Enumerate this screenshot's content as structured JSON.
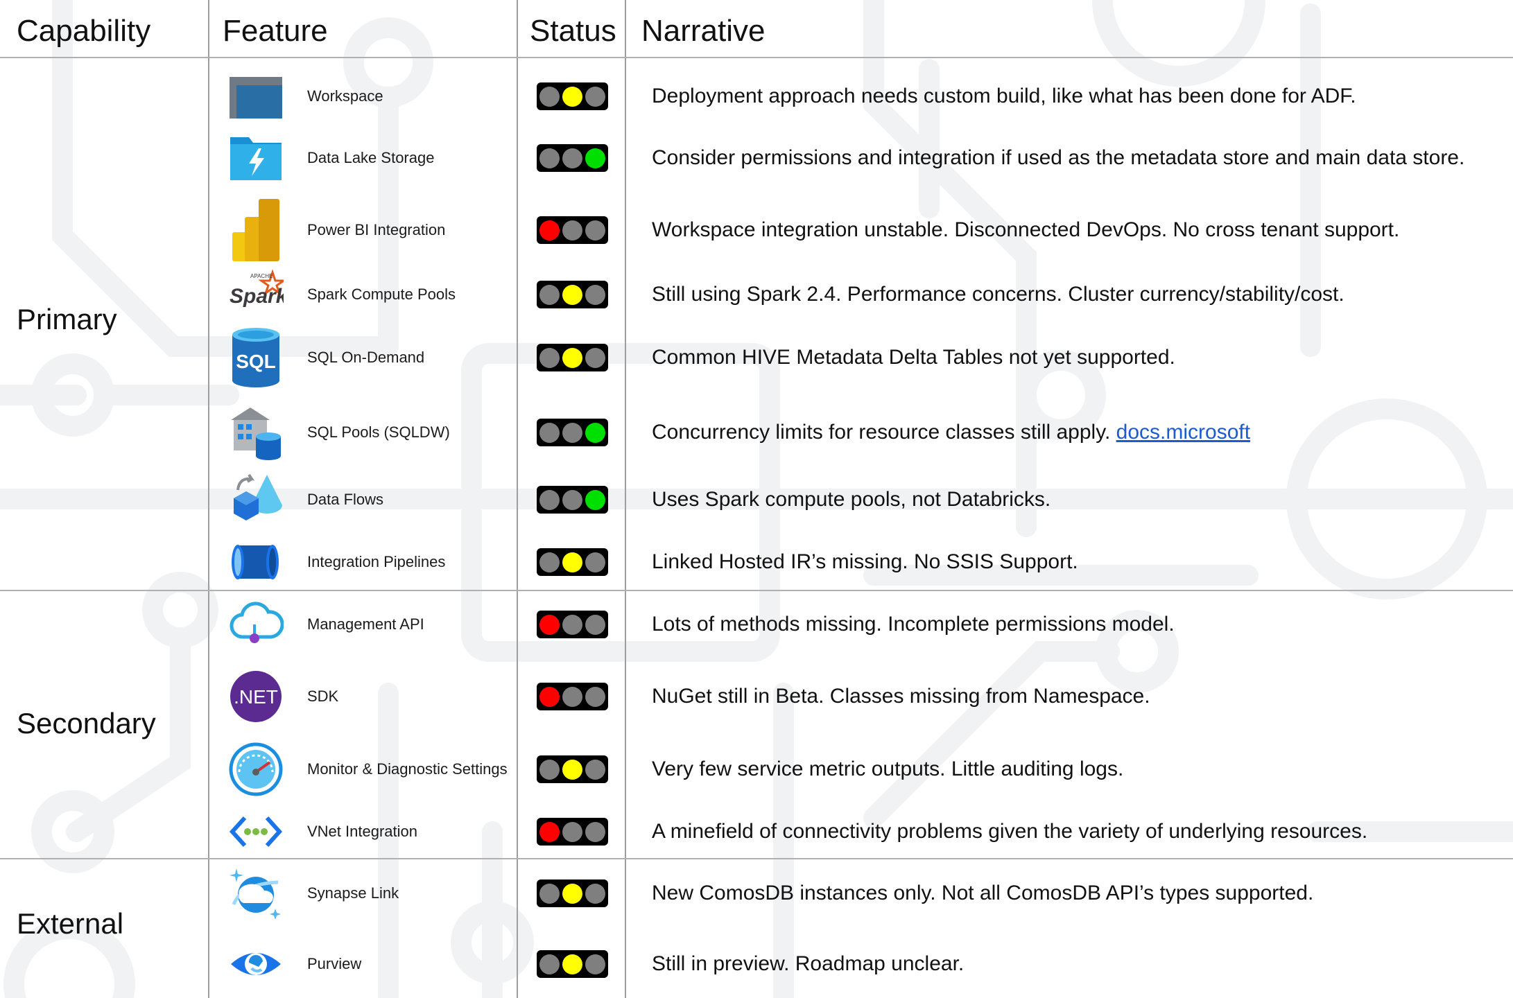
{
  "headers": {
    "capability": "Capability",
    "feature": "Feature",
    "status": "Status",
    "narrative": "Narrative"
  },
  "colors": {
    "red": "#ff0000",
    "yellow": "#ffff00",
    "green": "#00e000",
    "off": "#7f7f7f",
    "link": "#1a5ccf",
    "watermark": "#f1f2f4"
  },
  "capabilities": [
    "Primary",
    "Secondary",
    "External"
  ],
  "rows": [
    {
      "feature": "Workspace",
      "icon": "workspace-icon",
      "status": "yellow",
      "narrative": "Deployment approach needs custom build, like what has been done for ADF.",
      "link": ""
    },
    {
      "feature": "Data Lake Storage",
      "icon": "data-lake-storage-icon",
      "status": "green",
      "narrative": "Consider permissions and integration if used as the metadata store and main data store.",
      "link": ""
    },
    {
      "feature": "Power BI Integration",
      "icon": "power-bi-icon",
      "status": "red",
      "narrative": "Workspace integration unstable. Disconnected DevOps. No cross tenant support.",
      "link": ""
    },
    {
      "feature": "Spark Compute Pools",
      "icon": "apache-spark-icon",
      "status": "yellow",
      "narrative": "Still using Spark 2.4. Performance concerns. Cluster currency/stability/cost.",
      "link": ""
    },
    {
      "feature": "SQL On-Demand",
      "icon": "sql-database-icon",
      "status": "yellow",
      "narrative": "Common HIVE Metadata Delta Tables not yet supported.",
      "link": ""
    },
    {
      "feature": "SQL Pools (SQLDW)",
      "icon": "sql-warehouse-icon",
      "status": "green",
      "narrative": "Concurrency limits for resource classes still apply. ",
      "link": "docs.microsoft"
    },
    {
      "feature": "Data Flows",
      "icon": "data-flows-icon",
      "status": "green",
      "narrative": "Uses Spark compute pools, not Databricks.",
      "link": ""
    },
    {
      "feature": "Integration Pipelines",
      "icon": "pipeline-icon",
      "status": "yellow",
      "narrative": "Linked Hosted IR’s missing. No SSIS Support.",
      "link": ""
    },
    {
      "feature": "Management API",
      "icon": "cloud-api-icon",
      "status": "red",
      "narrative": "Lots of methods missing. Incomplete permissions model.",
      "link": ""
    },
    {
      "feature": "SDK",
      "icon": "dotnet-icon",
      "status": "red",
      "narrative": "NuGet still in Beta. Classes missing from Namespace.",
      "link": ""
    },
    {
      "feature": "Monitor & Diagnostic Settings",
      "icon": "monitor-gauge-icon",
      "status": "yellow",
      "narrative": "Very few service metric outputs. Little auditing logs.",
      "link": ""
    },
    {
      "feature": "VNet Integration",
      "icon": "vnet-icon",
      "status": "red",
      "narrative": "A minefield of connectivity problems given the variety of underlying resources.",
      "link": ""
    },
    {
      "feature": "Synapse Link",
      "icon": "cosmos-db-icon",
      "status": "yellow",
      "narrative": "New ComosDB instances only. Not all ComosDB API’s types supported.",
      "link": ""
    },
    {
      "feature": "Purview",
      "icon": "purview-icon",
      "status": "yellow",
      "narrative": "Still in preview. Roadmap unclear.",
      "link": ""
    }
  ],
  "dotnet_text": ".NET",
  "sql_text": "SQL",
  "spark_text": "Spark",
  "spark_apache": "APACHE"
}
